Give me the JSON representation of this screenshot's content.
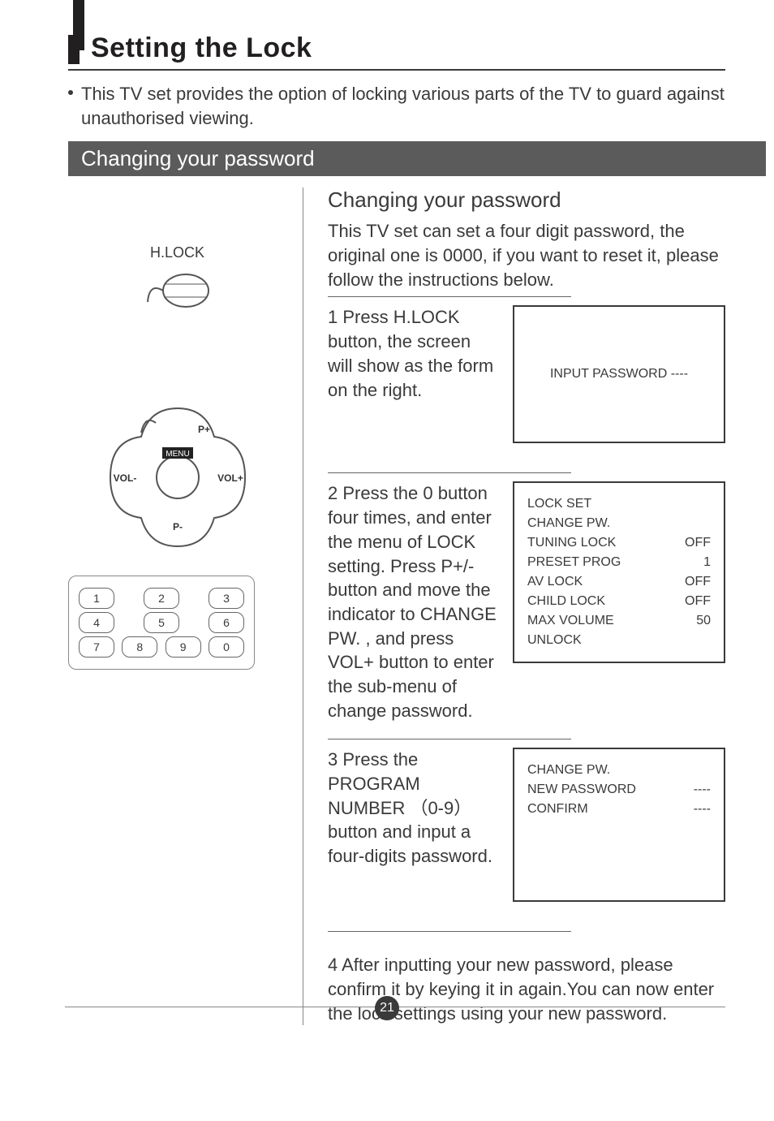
{
  "page": {
    "page_number": "21",
    "heading": "Setting the Lock",
    "intro": "This TV set provides the option of locking various parts of the TV to guard against unauthorised viewing.",
    "section_bar": "Changing your password"
  },
  "left": {
    "hlock_label": "H.LOCK",
    "nav": {
      "menu": "MENU",
      "vol_minus": "VOL-",
      "vol_plus": "VOL+",
      "p_plus": "P+",
      "p_minus": "P-"
    },
    "keypad": [
      "1",
      "2",
      "3",
      "4",
      "5",
      "6",
      "7",
      "8",
      "9",
      "0"
    ]
  },
  "right": {
    "sub_heading": "Changing your  password",
    "sub_intro": "This TV set can set a four digit password, the original one is 0000, if you want to reset it, please follow the  instructions below.",
    "step1": "1 Press H.LOCK button, the screen will show as the form on the right.",
    "osd1": "INPUT PASSWORD ----",
    "step2": "2 Press the 0 button four times, and enter the menu of LOCK setting. Press P+/- button and move the indicator to CHANGE PW. , and press VOL+ button to enter the sub-menu of change password.",
    "osd2": {
      "title": "LOCK SET",
      "rows": [
        {
          "l": "CHANGE PW.",
          "r": ""
        },
        {
          "l": "TUNING LOCK",
          "r": "OFF"
        },
        {
          "l": "PRESET PROG",
          "r": "1"
        },
        {
          "l": "AV LOCK",
          "r": "OFF"
        },
        {
          "l": "CHILD LOCK",
          "r": "OFF"
        },
        {
          "l": "MAX VOLUME",
          "r": "50"
        },
        {
          "l": "UNLOCK",
          "r": ""
        }
      ]
    },
    "step3": "3 Press the PROGRAM NUMBER （0-9）button and input a four-digits password.",
    "osd3": {
      "rows": [
        {
          "l": "CHANGE PW.",
          "r": ""
        },
        {
          "l": "NEW  PASSWORD",
          "r": "----"
        },
        {
          "l": "CONFIRM",
          "r": "----"
        }
      ]
    },
    "step4": "4 After inputting your new password, please confirm it by keying it in again.You can now enter the lock settings using your new password."
  }
}
